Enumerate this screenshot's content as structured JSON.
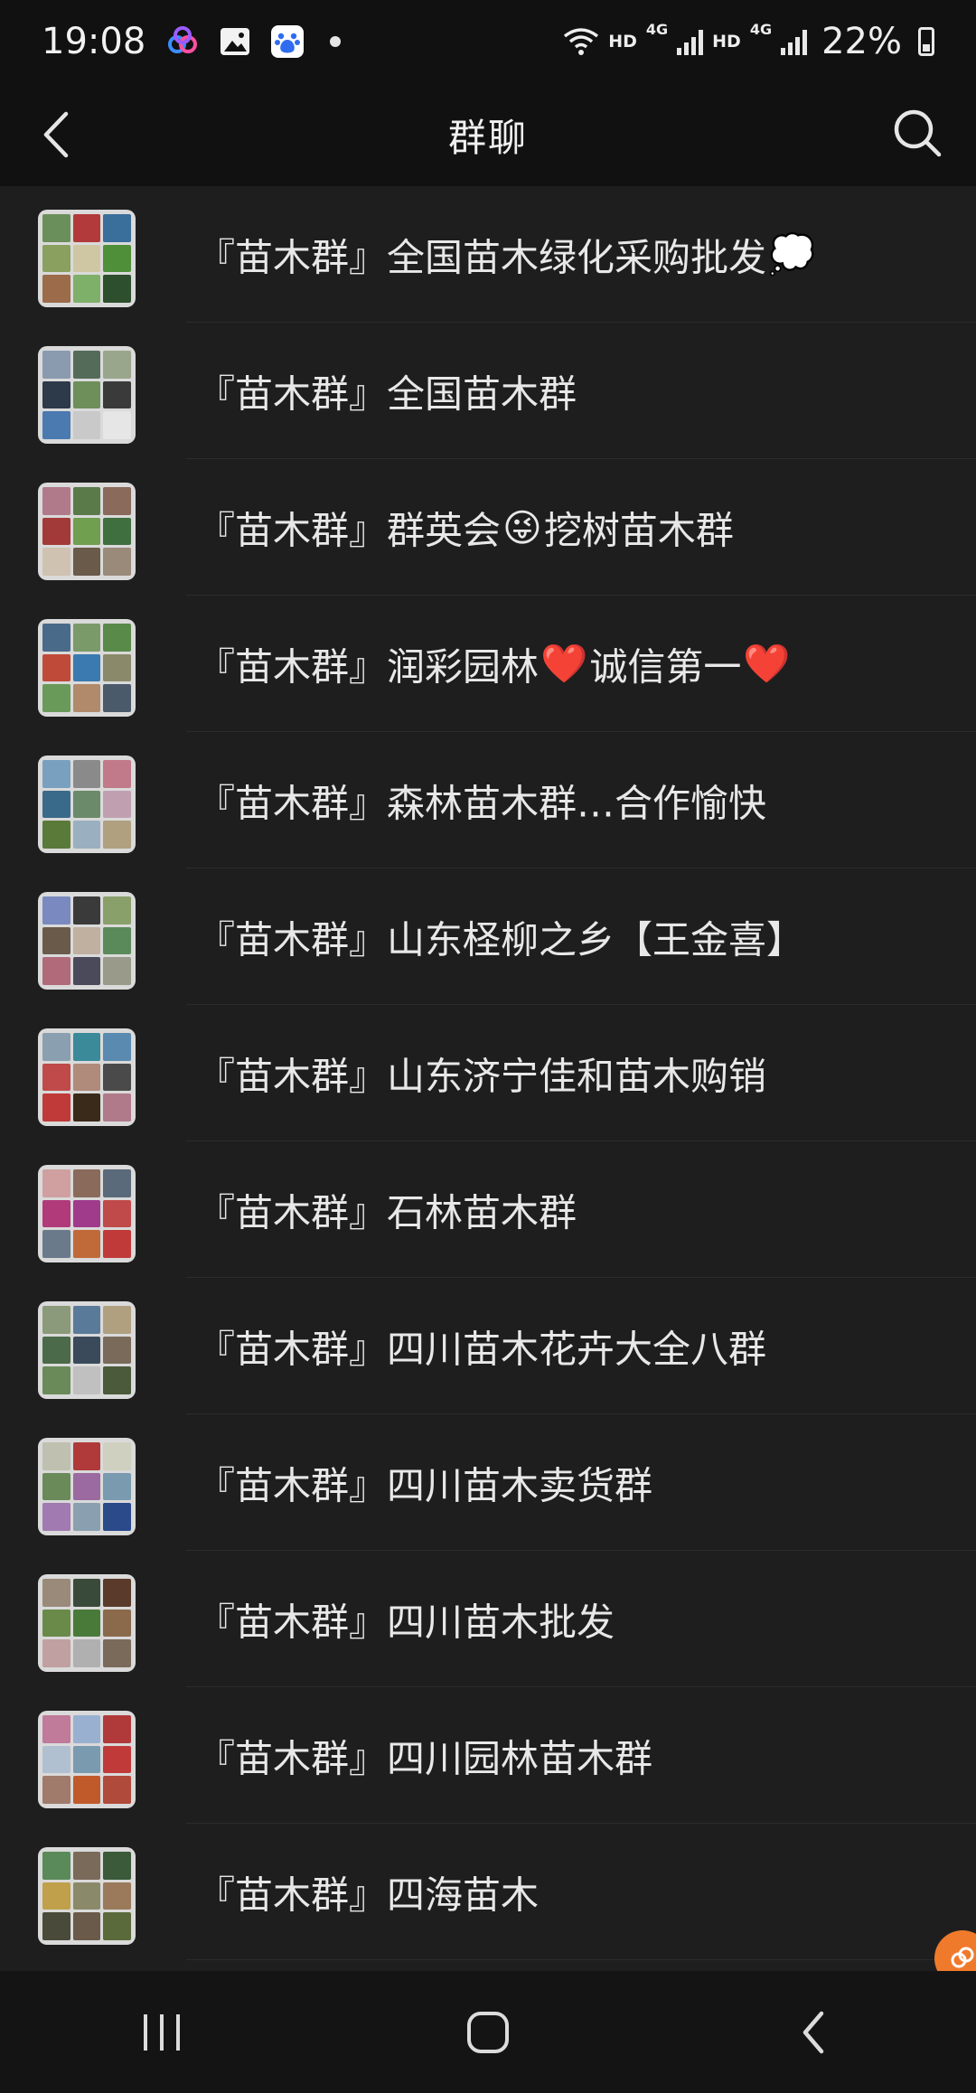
{
  "status_bar": {
    "time": "19:08",
    "network_label_1": "HD",
    "network_type_1": "4G",
    "network_label_2": "HD",
    "network_type_2": "4G",
    "battery": "22%"
  },
  "header": {
    "title": "群聊",
    "back_icon": "chevron-left-icon",
    "search_icon": "search-icon"
  },
  "groups": [
    {
      "prefix": "『苗木群』",
      "name": "全国苗木绿化采购批发",
      "emoji": "💭",
      "emoji_after": ""
    },
    {
      "prefix": "『苗木群』",
      "name": "全国苗木群",
      "emoji": "",
      "emoji_after": ""
    },
    {
      "prefix": "『苗木群』",
      "name": "群英会",
      "emoji": "😜",
      "emoji_after": "挖树苗木群"
    },
    {
      "prefix": "『苗木群』",
      "name": "润彩园林",
      "emoji": "❤️",
      "emoji_after": "诚信第一",
      "emoji2": "❤️"
    },
    {
      "prefix": "『苗木群』",
      "name": "森林苗木群…合作愉快",
      "emoji": "",
      "emoji_after": ""
    },
    {
      "prefix": "『苗木群』",
      "name": "山东柽柳之乡【王金喜】",
      "emoji": "",
      "emoji_after": ""
    },
    {
      "prefix": "『苗木群』",
      "name": "山东济宁佳和苗木购销",
      "emoji": "",
      "emoji_after": ""
    },
    {
      "prefix": "『苗木群』",
      "name": "石林苗木群",
      "emoji": "",
      "emoji_after": ""
    },
    {
      "prefix": "『苗木群』",
      "name": "四川苗木花卉大全八群",
      "emoji": "",
      "emoji_after": ""
    },
    {
      "prefix": "『苗木群』",
      "name": "四川苗木卖货群",
      "emoji": "",
      "emoji_after": ""
    },
    {
      "prefix": "『苗木群』",
      "name": "四川苗木批发",
      "emoji": "",
      "emoji_after": ""
    },
    {
      "prefix": "『苗木群』",
      "name": "四川园林苗木群",
      "emoji": "",
      "emoji_after": ""
    },
    {
      "prefix": "『苗木群』",
      "name": "四海苗木",
      "emoji": "",
      "emoji_after": ""
    }
  ],
  "nav": {
    "recents_icon": "recent-apps-icon",
    "home_icon": "home-icon",
    "back_icon": "back-icon"
  },
  "colors": {
    "background": "#1e1e1e",
    "header": "#111111",
    "text": "#e8e8e8",
    "accent_float": "#f07a2c"
  }
}
